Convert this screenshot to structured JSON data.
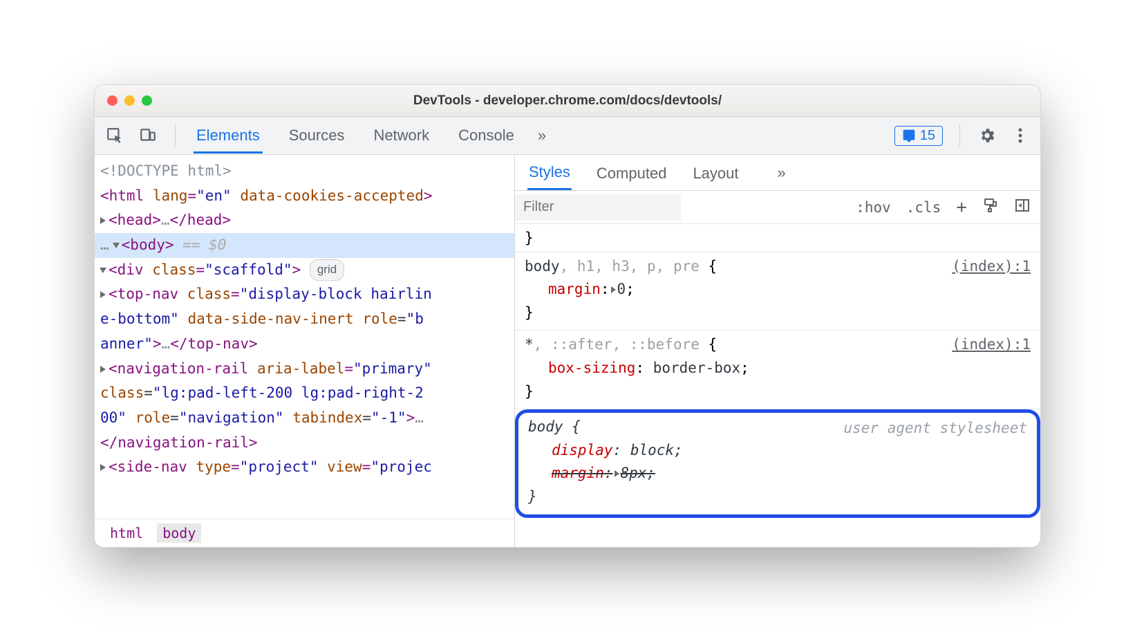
{
  "window": {
    "title": "DevTools - developer.chrome.com/docs/devtools/"
  },
  "toolbar": {
    "tabs": [
      "Elements",
      "Sources",
      "Network",
      "Console"
    ],
    "active": 0,
    "issues_count": "15"
  },
  "dom": {
    "doctype": "<!DOCTYPE html>",
    "html_open": {
      "tag": "html",
      "attrs": "lang=\"en\" data-cookies-accepted"
    },
    "head": {
      "open": "<head>",
      "ellipsis": "…",
      "close": "</head>"
    },
    "body": {
      "open": "<body>",
      "eq": "== $0"
    },
    "scaffold": {
      "open": "<div class=\"scaffold\">",
      "pill": "grid"
    },
    "topnav_l1": "<top-nav class=\"display-block hairlin",
    "topnav_l2": "e-bottom\" data-side-nav-inert role=\"b",
    "topnav_l3": "anner\">…</top-nav>",
    "navrail_l1": "<navigation-rail aria-label=\"primary\"",
    "navrail_l2": "class=\"lg:pad-left-200 lg:pad-right-2",
    "navrail_l3": "00\" role=\"navigation\" tabindex=\"-1\">…",
    "navrail_l4": "</navigation-rail>",
    "sidenav": "<side-nav type=\"project\" view=\"projec"
  },
  "crumbs": [
    "html",
    "body"
  ],
  "styles": {
    "tabs": [
      "Styles",
      "Computed",
      "Layout"
    ],
    "active": 0,
    "filter_placeholder": "Filter",
    "hov": ":hov",
    "cls": ".cls",
    "rules": [
      {
        "selector_main": "body",
        "selector_rest": ", h1, h3, p, pre",
        "brace": " {",
        "src": "(index):1",
        "props": [
          {
            "name": "margin",
            "arrow": true,
            "value": "0"
          }
        ]
      },
      {
        "selector_main": "*",
        "selector_rest": ", ::after, ::before",
        "brace": " {",
        "src": "(index):1",
        "props": [
          {
            "name": "box-sizing",
            "value": "border-box"
          }
        ]
      }
    ],
    "ua_rule": {
      "selector": "body {",
      "src": "user agent stylesheet",
      "props": [
        {
          "name": "display",
          "value": "block"
        },
        {
          "name": "margin",
          "arrow": true,
          "value": "8px",
          "strike": true
        }
      ]
    }
  }
}
